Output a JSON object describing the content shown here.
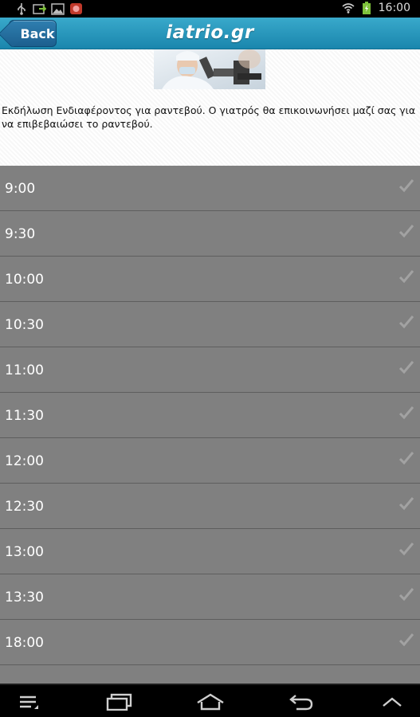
{
  "status_bar": {
    "time": "16:00",
    "icons": [
      "usb-icon",
      "screenshot-icon",
      "gallery-icon",
      "app-notification-icon",
      "wifi-icon",
      "battery-icon"
    ]
  },
  "header": {
    "back_label": "Back",
    "logo_text": "iatrio.gr",
    "accent_color": "#2196c0"
  },
  "info": {
    "image": "doctor-microscope-image",
    "text": "Εκδήλωση Ενδιαφέροντος για ραντεβού. Ο γιατρός θα επικοινωνήσει μαζί σας για να επιβεβαιώσει το ραντεβού."
  },
  "slots": [
    {
      "time": "9:00"
    },
    {
      "time": "9:30"
    },
    {
      "time": "10:00"
    },
    {
      "time": "10:30"
    },
    {
      "time": "11:00"
    },
    {
      "time": "11:30"
    },
    {
      "time": "12:00"
    },
    {
      "time": "12:30"
    },
    {
      "time": "13:00"
    },
    {
      "time": "13:30"
    },
    {
      "time": "18:00"
    },
    {
      "time": ""
    }
  ],
  "nav_bar": {
    "icons": [
      "menu-icon",
      "recent-apps-icon",
      "home-icon",
      "back-icon",
      "expand-icon"
    ]
  }
}
